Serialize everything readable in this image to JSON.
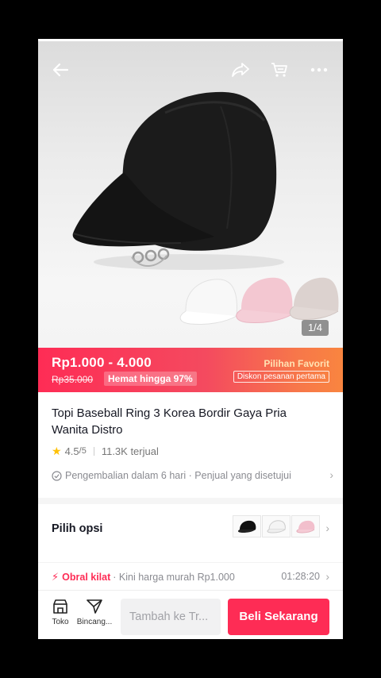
{
  "hero": {
    "image_counter": "1/4",
    "icons": [
      "back-arrow-icon",
      "share-icon",
      "cart-icon",
      "more-icon"
    ]
  },
  "price": {
    "range": "Rp1.000 - 4.000",
    "original": "Rp35.000",
    "savings": "Hemat hingga 97%",
    "favorite_label": "Pilihan Favorit",
    "first_order_discount": "Diskon pesanan pertama"
  },
  "product": {
    "title": "Topi Baseball Ring 3 Korea Bordir Gaya Pria Wanita Distro",
    "rating": "4.5",
    "rating_scale": "/5",
    "sold": "11.3K terjual",
    "policy": "Pengembalian dalam 6 hari · Penjual yang disetujui"
  },
  "options": {
    "label": "Pilih opsi",
    "colors": [
      "#111111",
      "#eeeeee",
      "#f2bfcc"
    ]
  },
  "flash_sale": {
    "label": "Obral kilat",
    "description": "· Kini harga murah Rp1.000",
    "timer": "01:28:20"
  },
  "bottom_bar": {
    "shop_label": "Toko",
    "chat_label": "Bincang...",
    "add_to_cart": "Tambah ke Tr...",
    "buy_now": "Beli Sekarang"
  },
  "colors": {
    "accent": "#fe2c55",
    "star": "#ffc107"
  }
}
